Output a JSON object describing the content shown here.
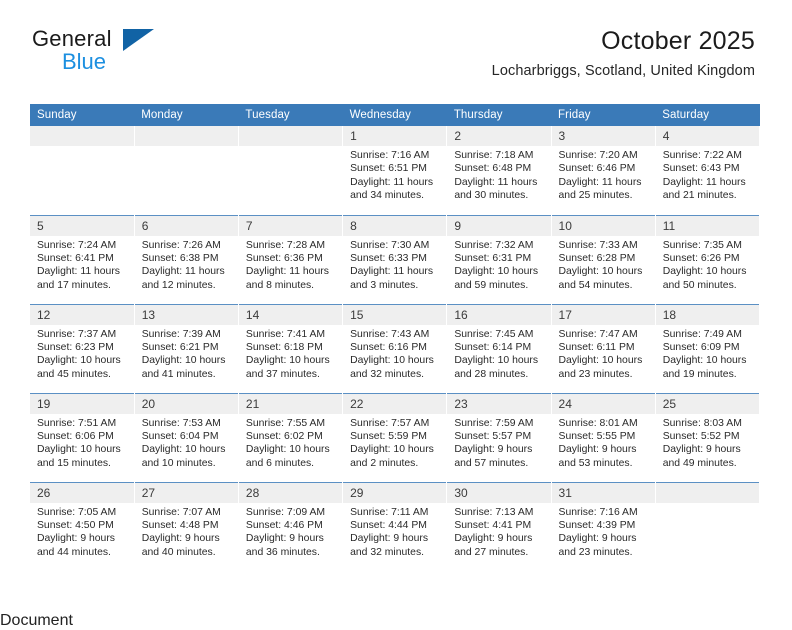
{
  "brand": {
    "line1": "General",
    "line2": "Blue",
    "triangle_color": "#1163a5",
    "line2_color": "#1c8fe0"
  },
  "header": {
    "title": "October 2025",
    "subtitle": "Locharbriggs, Scotland, United Kingdom"
  },
  "theme": {
    "header_row_bg": "#3a7ab8",
    "header_row_text": "#ffffff",
    "daynum_bg": "#efefef",
    "row_divider": "#5b90c4"
  },
  "calendar": {
    "weekday_headers": [
      "Sunday",
      "Monday",
      "Tuesday",
      "Wednesday",
      "Thursday",
      "Friday",
      "Saturday"
    ],
    "labels": {
      "sunrise": "Sunrise:",
      "sunset": "Sunset:",
      "daylight": "Daylight:"
    },
    "weeks": [
      [
        {
          "day": "",
          "empty": true
        },
        {
          "day": "",
          "empty": true
        },
        {
          "day": "",
          "empty": true
        },
        {
          "day": "1",
          "sunrise": "Sunrise: 7:16 AM",
          "sunset": "Sunset: 6:51 PM",
          "daylight": "Daylight: 11 hours and 34 minutes."
        },
        {
          "day": "2",
          "sunrise": "Sunrise: 7:18 AM",
          "sunset": "Sunset: 6:48 PM",
          "daylight": "Daylight: 11 hours and 30 minutes."
        },
        {
          "day": "3",
          "sunrise": "Sunrise: 7:20 AM",
          "sunset": "Sunset: 6:46 PM",
          "daylight": "Daylight: 11 hours and 25 minutes."
        },
        {
          "day": "4",
          "sunrise": "Sunrise: 7:22 AM",
          "sunset": "Sunset: 6:43 PM",
          "daylight": "Daylight: 11 hours and 21 minutes."
        }
      ],
      [
        {
          "day": "5",
          "sunrise": "Sunrise: 7:24 AM",
          "sunset": "Sunset: 6:41 PM",
          "daylight": "Daylight: 11 hours and 17 minutes."
        },
        {
          "day": "6",
          "sunrise": "Sunrise: 7:26 AM",
          "sunset": "Sunset: 6:38 PM",
          "daylight": "Daylight: 11 hours and 12 minutes."
        },
        {
          "day": "7",
          "sunrise": "Sunrise: 7:28 AM",
          "sunset": "Sunset: 6:36 PM",
          "daylight": "Daylight: 11 hours and 8 minutes."
        },
        {
          "day": "8",
          "sunrise": "Sunrise: 7:30 AM",
          "sunset": "Sunset: 6:33 PM",
          "daylight": "Daylight: 11 hours and 3 minutes."
        },
        {
          "day": "9",
          "sunrise": "Sunrise: 7:32 AM",
          "sunset": "Sunset: 6:31 PM",
          "daylight": "Daylight: 10 hours and 59 minutes."
        },
        {
          "day": "10",
          "sunrise": "Sunrise: 7:33 AM",
          "sunset": "Sunset: 6:28 PM",
          "daylight": "Daylight: 10 hours and 54 minutes."
        },
        {
          "day": "11",
          "sunrise": "Sunrise: 7:35 AM",
          "sunset": "Sunset: 6:26 PM",
          "daylight": "Daylight: 10 hours and 50 minutes."
        }
      ],
      [
        {
          "day": "12",
          "sunrise": "Sunrise: 7:37 AM",
          "sunset": "Sunset: 6:23 PM",
          "daylight": "Daylight: 10 hours and 45 minutes."
        },
        {
          "day": "13",
          "sunrise": "Sunrise: 7:39 AM",
          "sunset": "Sunset: 6:21 PM",
          "daylight": "Daylight: 10 hours and 41 minutes."
        },
        {
          "day": "14",
          "sunrise": "Sunrise: 7:41 AM",
          "sunset": "Sunset: 6:18 PM",
          "daylight": "Daylight: 10 hours and 37 minutes."
        },
        {
          "day": "15",
          "sunrise": "Sunrise: 7:43 AM",
          "sunset": "Sunset: 6:16 PM",
          "daylight": "Daylight: 10 hours and 32 minutes."
        },
        {
          "day": "16",
          "sunrise": "Sunrise: 7:45 AM",
          "sunset": "Sunset: 6:14 PM",
          "daylight": "Daylight: 10 hours and 28 minutes."
        },
        {
          "day": "17",
          "sunrise": "Sunrise: 7:47 AM",
          "sunset": "Sunset: 6:11 PM",
          "daylight": "Daylight: 10 hours and 23 minutes."
        },
        {
          "day": "18",
          "sunrise": "Sunrise: 7:49 AM",
          "sunset": "Sunset: 6:09 PM",
          "daylight": "Daylight: 10 hours and 19 minutes."
        }
      ],
      [
        {
          "day": "19",
          "sunrise": "Sunrise: 7:51 AM",
          "sunset": "Sunset: 6:06 PM",
          "daylight": "Daylight: 10 hours and 15 minutes."
        },
        {
          "day": "20",
          "sunrise": "Sunrise: 7:53 AM",
          "sunset": "Sunset: 6:04 PM",
          "daylight": "Daylight: 10 hours and 10 minutes."
        },
        {
          "day": "21",
          "sunrise": "Sunrise: 7:55 AM",
          "sunset": "Sunset: 6:02 PM",
          "daylight": "Daylight: 10 hours and 6 minutes."
        },
        {
          "day": "22",
          "sunrise": "Sunrise: 7:57 AM",
          "sunset": "Sunset: 5:59 PM",
          "daylight": "Daylight: 10 hours and 2 minutes."
        },
        {
          "day": "23",
          "sunrise": "Sunrise: 7:59 AM",
          "sunset": "Sunset: 5:57 PM",
          "daylight": "Daylight: 9 hours and 57 minutes."
        },
        {
          "day": "24",
          "sunrise": "Sunrise: 8:01 AM",
          "sunset": "Sunset: 5:55 PM",
          "daylight": "Daylight: 9 hours and 53 minutes."
        },
        {
          "day": "25",
          "sunrise": "Sunrise: 8:03 AM",
          "sunset": "Sunset: 5:52 PM",
          "daylight": "Daylight: 9 hours and 49 minutes."
        }
      ],
      [
        {
          "day": "26",
          "sunrise": "Sunrise: 7:05 AM",
          "sunset": "Sunset: 4:50 PM",
          "daylight": "Daylight: 9 hours and 44 minutes."
        },
        {
          "day": "27",
          "sunrise": "Sunrise: 7:07 AM",
          "sunset": "Sunset: 4:48 PM",
          "daylight": "Daylight: 9 hours and 40 minutes."
        },
        {
          "day": "28",
          "sunrise": "Sunrise: 7:09 AM",
          "sunset": "Sunset: 4:46 PM",
          "daylight": "Daylight: 9 hours and 36 minutes."
        },
        {
          "day": "29",
          "sunrise": "Sunrise: 7:11 AM",
          "sunset": "Sunset: 4:44 PM",
          "daylight": "Daylight: 9 hours and 32 minutes."
        },
        {
          "day": "30",
          "sunrise": "Sunrise: 7:13 AM",
          "sunset": "Sunset: 4:41 PM",
          "daylight": "Daylight: 9 hours and 27 minutes."
        },
        {
          "day": "31",
          "sunrise": "Sunrise: 7:16 AM",
          "sunset": "Sunset: 4:39 PM",
          "daylight": "Daylight: 9 hours and 23 minutes."
        },
        {
          "day": "",
          "empty": true
        }
      ]
    ]
  }
}
